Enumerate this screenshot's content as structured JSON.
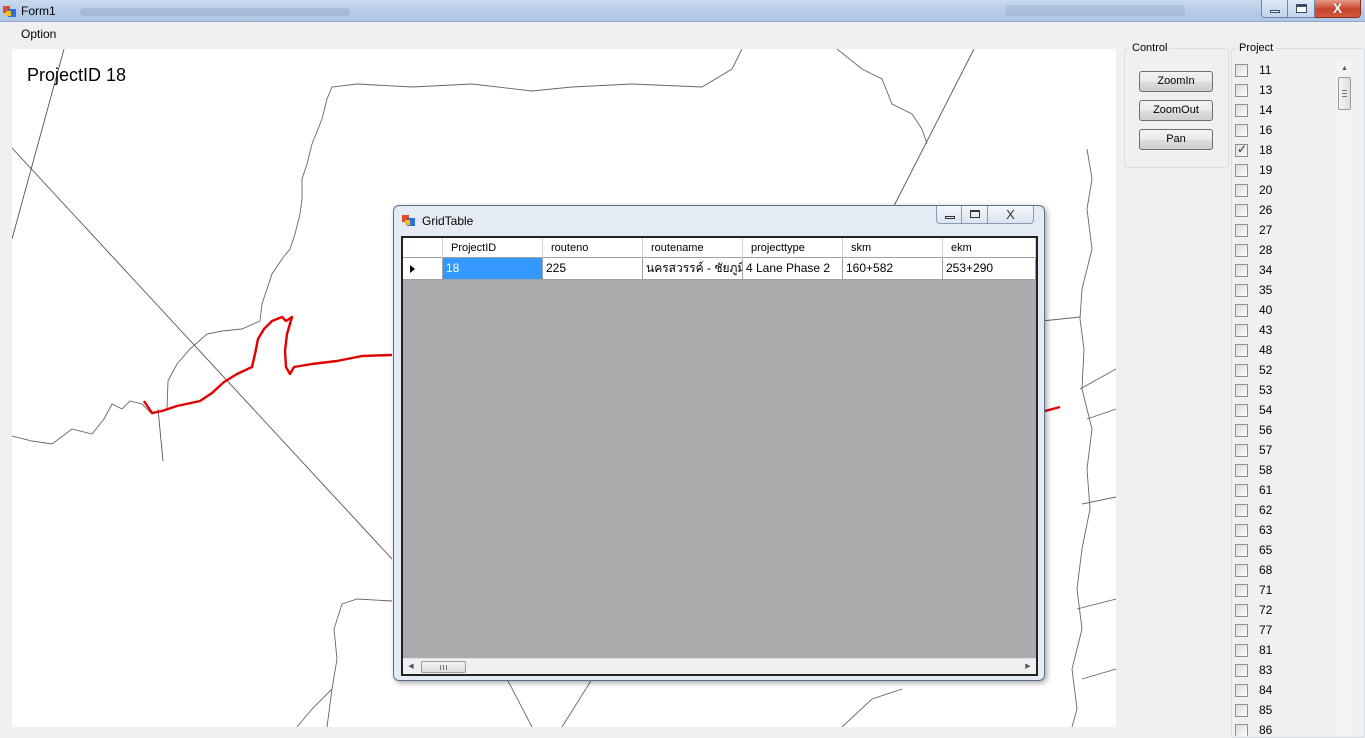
{
  "window": {
    "title": "Form1",
    "minimize_label": "_",
    "maximize_label": "□",
    "close_label": "X"
  },
  "menu": {
    "option_label": "Option"
  },
  "map": {
    "project_label": "ProjectID 18",
    "route_color": "#e00000",
    "road_color": "#555555"
  },
  "control": {
    "title": "Control",
    "zoomin_label": "ZoomIn",
    "zoomout_label": "ZoomOut",
    "pan_label": "Pan"
  },
  "project": {
    "title": "Project",
    "items": [
      {
        "label": "11",
        "checked": false
      },
      {
        "label": "13",
        "checked": false
      },
      {
        "label": "14",
        "checked": false
      },
      {
        "label": "16",
        "checked": false
      },
      {
        "label": "18",
        "checked": true
      },
      {
        "label": "19",
        "checked": false
      },
      {
        "label": "20",
        "checked": false
      },
      {
        "label": "26",
        "checked": false
      },
      {
        "label": "27",
        "checked": false
      },
      {
        "label": "28",
        "checked": false
      },
      {
        "label": "34",
        "checked": false
      },
      {
        "label": "35",
        "checked": false
      },
      {
        "label": "40",
        "checked": false
      },
      {
        "label": "43",
        "checked": false
      },
      {
        "label": "48",
        "checked": false
      },
      {
        "label": "52",
        "checked": false
      },
      {
        "label": "53",
        "checked": false
      },
      {
        "label": "54",
        "checked": false
      },
      {
        "label": "56",
        "checked": false
      },
      {
        "label": "57",
        "checked": false
      },
      {
        "label": "58",
        "checked": false
      },
      {
        "label": "61",
        "checked": false
      },
      {
        "label": "62",
        "checked": false
      },
      {
        "label": "63",
        "checked": false
      },
      {
        "label": "65",
        "checked": false
      },
      {
        "label": "68",
        "checked": false
      },
      {
        "label": "71",
        "checked": false
      },
      {
        "label": "72",
        "checked": false
      },
      {
        "label": "77",
        "checked": false
      },
      {
        "label": "81",
        "checked": false
      },
      {
        "label": "83",
        "checked": false
      },
      {
        "label": "84",
        "checked": false
      },
      {
        "label": "85",
        "checked": false
      },
      {
        "label": "86",
        "checked": false
      }
    ]
  },
  "grid_window": {
    "title": "GridTable",
    "columns": [
      "ProjectID",
      "routeno",
      "routename",
      "projecttype",
      "skm",
      "ekm"
    ],
    "rows": [
      [
        "18",
        "225",
        "นครสวรรค์ - ชัยภูมิ",
        "4 Lane Phase 2",
        "160+582",
        "253+290"
      ]
    ]
  }
}
